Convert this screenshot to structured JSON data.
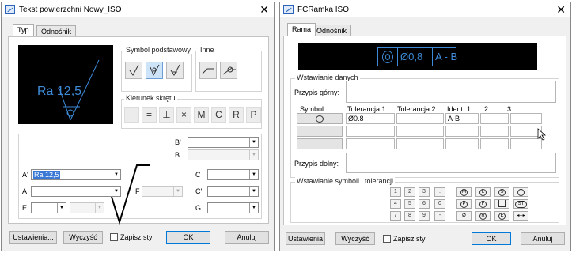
{
  "left": {
    "title": "Tekst powierzchni Nowy_ISO",
    "tabs": [
      "Typ",
      "Odnośnik"
    ],
    "preview_text": "Ra 12,5",
    "symbol_group": "Symbol podstawowy",
    "other_group": "Inne",
    "direction_group": "Kierunek skrętu",
    "direction_keys": [
      "=",
      "⊥",
      "×",
      "M",
      "C",
      "R",
      "P"
    ],
    "fields": {
      "b_prime": "B'",
      "b": "B",
      "a_prime": "A'",
      "a": "A",
      "e": "E",
      "f": "F",
      "c": "C",
      "c_prime": "C'",
      "g": "G"
    },
    "a_prime_value": "Ra 12,5",
    "buttons": {
      "settings": "Ustawienia...",
      "clear": "Wyczyść",
      "save_style": "Zapisz styl",
      "ok": "OK",
      "cancel": "Anuluj"
    }
  },
  "right": {
    "title": "FCRamka ISO",
    "tabs": [
      "Rama",
      "Odnośnik"
    ],
    "preview": {
      "diameter": "Ø0,8",
      "datum": "A - B"
    },
    "data_group": "Wstawianie danych",
    "upper_label": "Przypis górny:",
    "lower_label": "Przypis dolny:",
    "headers": [
      "Symbol",
      "Tolerancja 1",
      "Tolerancja 2",
      "Ident. 1",
      "2",
      "3"
    ],
    "row1": {
      "tol1": "Ø0.8",
      "ident1": "A-B"
    },
    "insert_group": "Wstawianie symboli i tolerancji",
    "numpad": [
      [
        "1",
        "2",
        "3",
        "."
      ],
      [
        "4",
        "5",
        "6",
        "0"
      ],
      [
        "7",
        "8",
        "9",
        "-"
      ]
    ],
    "glyphs": [
      [
        "M",
        "L",
        "S",
        "T"
      ],
      [
        "P",
        "F",
        "",
        "ST"
      ],
      [
        "",
        "R",
        "E",
        ""
      ]
    ],
    "buttons": {
      "settings": "Ustawienia",
      "clear": "Wyczyść",
      "save_style": "Zapisz styl",
      "ok": "OK",
      "cancel": "Anuluj"
    }
  }
}
